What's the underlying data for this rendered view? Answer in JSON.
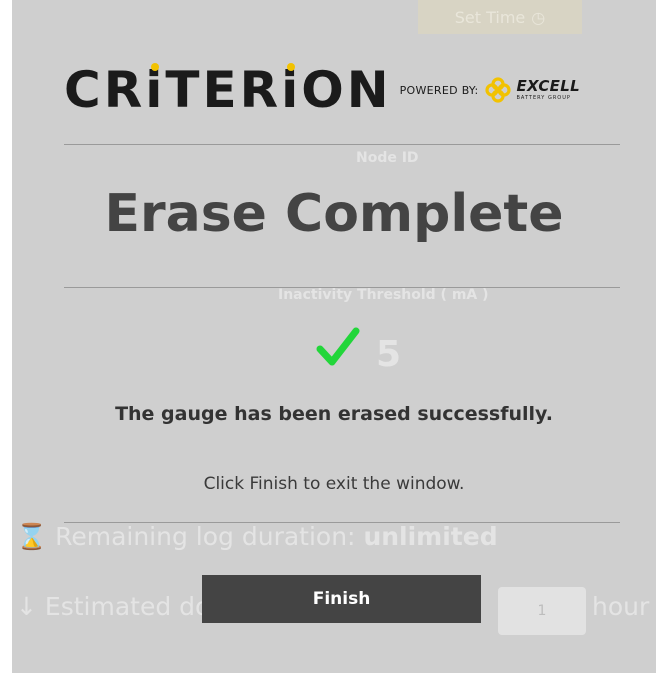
{
  "background": {
    "set_time_label": "Set Time",
    "node_id_label": "Node ID",
    "threshold_label": "Inactivity Threshold ( mA )",
    "threshold_value": "5",
    "log_duration_label": "Remaining log duration:",
    "log_duration_value": "unlimited",
    "estimated_label": "Estimated do",
    "hours_value": "1",
    "hours_label": "hour"
  },
  "modal": {
    "logo_text_1": "CR",
    "logo_text_i1": "i",
    "logo_text_2": "TER",
    "logo_text_i2": "i",
    "logo_text_3": "ON",
    "powered_by": "POWERED BY:",
    "partner_brand": "EXCELL",
    "partner_sub": "BATTERY GROUP",
    "title": "Erase Complete",
    "message": "The gauge has been erased successfully.",
    "hint": "Click Finish to exit the window.",
    "finish_label": "Finish"
  },
  "colors": {
    "check": "#22d63a",
    "button": "#444444",
    "logo_accent": "#f2c200"
  }
}
